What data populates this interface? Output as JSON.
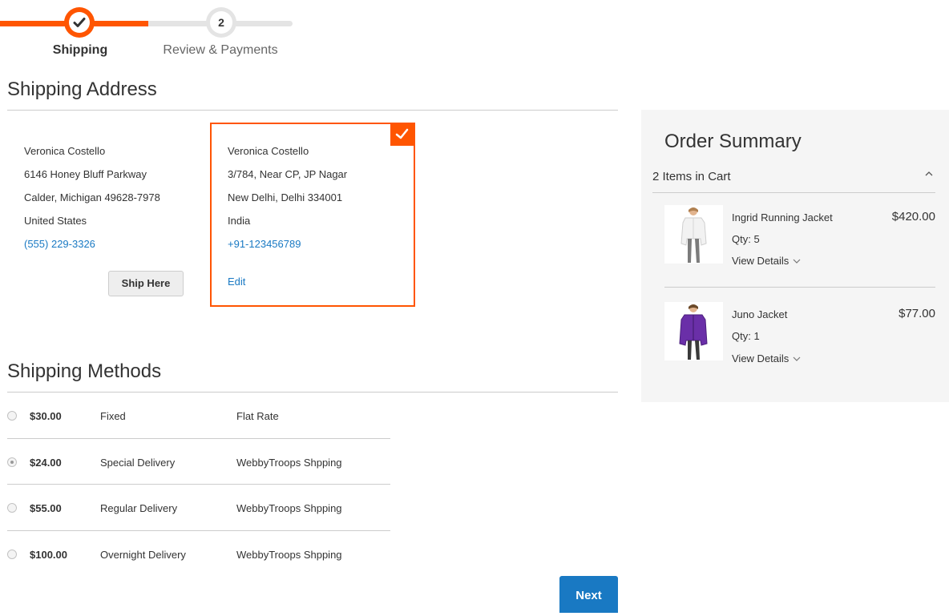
{
  "progress": {
    "steps": [
      {
        "number": "1",
        "label": "Shipping",
        "state": "complete"
      },
      {
        "number": "2",
        "label": "Review & Payments",
        "state": "pending"
      }
    ],
    "accent_color": "#ff5501"
  },
  "shipping_address": {
    "title": "Shipping Address",
    "addresses": [
      {
        "name": "Veronica Costello",
        "street": "6146 Honey Bluff Parkway",
        "city_line": "Calder, Michigan 49628-7978",
        "country": "United States",
        "phone": "(555) 229-3326",
        "action_label": "Ship Here",
        "selected": false
      },
      {
        "name": "Veronica Costello",
        "street": "3/784, Near CP, JP Nagar",
        "city_line": "New Delhi, Delhi 334001",
        "country": "India",
        "phone": "+91-123456789",
        "action_label": "Edit",
        "selected": true
      }
    ]
  },
  "shipping_methods": {
    "title": "Shipping Methods",
    "methods": [
      {
        "price": "$30.00",
        "method": "Fixed",
        "carrier": "Flat Rate",
        "selected": false
      },
      {
        "price": "$24.00",
        "method": "Special Delivery",
        "carrier": "WebbyTroops Shpping",
        "selected": true
      },
      {
        "price": "$55.00",
        "method": "Regular Delivery",
        "carrier": "WebbyTroops Shpping",
        "selected": false
      },
      {
        "price": "$100.00",
        "method": "Overnight Delivery",
        "carrier": "WebbyTroops Shpping",
        "selected": false
      }
    ],
    "next_label": "Next"
  },
  "order_summary": {
    "title": "Order Summary",
    "items_in_cart": "2 Items in Cart",
    "items": [
      {
        "name": "Ingrid Running Jacket",
        "qty": "Qty: 5",
        "price": "$420.00",
        "details_label": "View Details",
        "thumb_icon": "white-jacket-product-icon"
      },
      {
        "name": "Juno Jacket",
        "qty": "Qty: 1",
        "price": "$77.00",
        "details_label": "View Details",
        "thumb_icon": "purple-jacket-product-icon"
      }
    ]
  },
  "colors": {
    "accent": "#ff5501",
    "link": "#1979c3",
    "primary_button": "#1979c3",
    "summary_bg": "#f5f5f5"
  }
}
